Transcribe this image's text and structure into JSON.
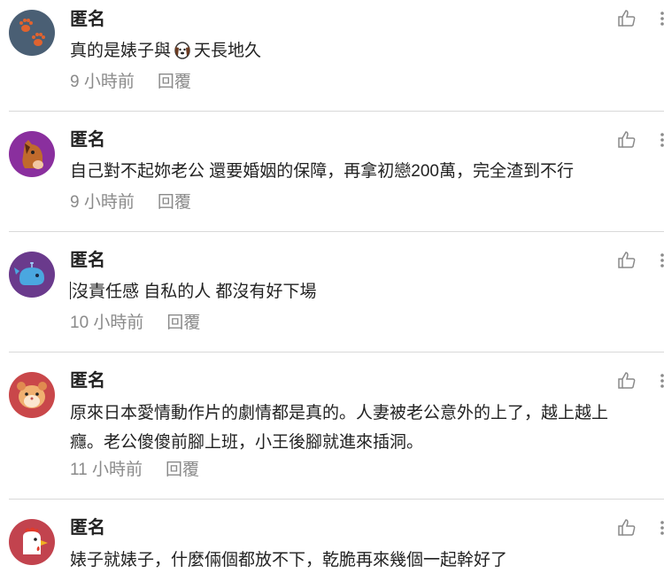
{
  "comments": [
    {
      "author": "匿名",
      "text_before": "真的是婊子與",
      "text_after": "天長地久",
      "time": "9 小時前",
      "reply": "回覆",
      "avatar": "paw-prints-icon",
      "avatar_bg": "#4a5f74"
    },
    {
      "author": "匿名",
      "text": "自己對不起妳老公 還要婚姻的保障，再拿初戀200萬，完全渣到不行",
      "time": "9 小時前",
      "reply": "回覆",
      "avatar": "horse-face-icon",
      "avatar_bg": "#8a2f9e"
    },
    {
      "author": "匿名",
      "text": "沒責任感 自私的人 都沒有好下場",
      "time": "10 小時前",
      "reply": "回覆",
      "avatar": "whale-icon",
      "avatar_bg": "#6a3a8c"
    },
    {
      "author": "匿名",
      "text_line1": "原來日本愛情動作片的劇情都是真的。人妻被老公意外的上了，越上越上",
      "text_line2": "癮。老公傻傻前腳上班，小王後腳就進來插洞。",
      "time": "11 小時前",
      "reply": "回覆",
      "avatar": "hamster-icon",
      "avatar_bg": "#c9474a"
    },
    {
      "author": "匿名",
      "text": "婊子就婊子，什麼倆個都放不下，乾脆再來幾個一起幹好了",
      "avatar": "rooster-icon",
      "avatar_bg": "#c2434e"
    }
  ],
  "colors": {
    "meta": "#8a8a8a",
    "divider": "#d9d9d9"
  }
}
